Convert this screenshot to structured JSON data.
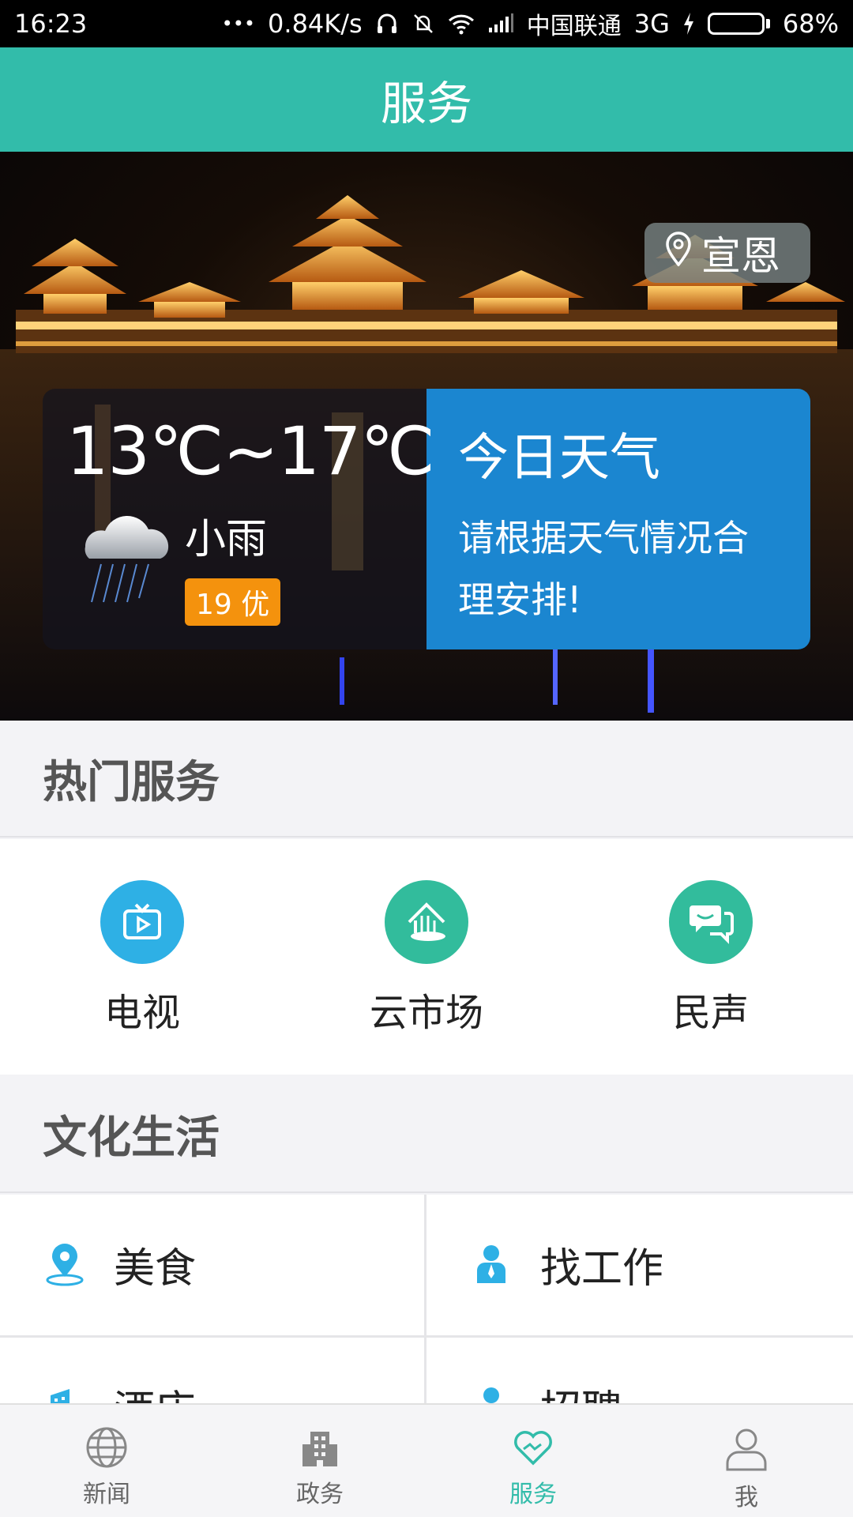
{
  "status_bar": {
    "time": "16:23",
    "dots": "•••",
    "speed": "0.84K/s",
    "carrier": "中国联通",
    "network": "3G",
    "battery": "68%",
    "battery_level": 0.68
  },
  "app_bar": {
    "title": "服务"
  },
  "hero": {
    "location": "宣恩",
    "weather": {
      "temp_range": "13℃~17℃",
      "condition": "小雨",
      "aqi": "19 优",
      "title": "今日天气",
      "desc_line1": "请根据天气情况合",
      "desc_line2": "理安排!"
    }
  },
  "hot_services": {
    "title": "热门服务",
    "items": [
      {
        "label": "电视",
        "icon": "tv-icon",
        "color": "#2eb0e5"
      },
      {
        "label": "云市场",
        "icon": "market-icon",
        "color": "#32bc9c"
      },
      {
        "label": "民声",
        "icon": "chat-icon",
        "color": "#32bc9c"
      }
    ]
  },
  "culture": {
    "title": "文化生活",
    "items": [
      {
        "label": "美食",
        "icon": "location-pin-icon"
      },
      {
        "label": "找工作",
        "icon": "person-icon"
      },
      {
        "label": "酒店",
        "icon": "building-icon"
      },
      {
        "label": "招聘",
        "icon": "person-icon"
      }
    ]
  },
  "bottom_nav": {
    "items": [
      {
        "label": "新闻",
        "icon": "globe-icon"
      },
      {
        "label": "政务",
        "icon": "government-building-icon"
      },
      {
        "label": "服务",
        "icon": "heart-icon",
        "active": true
      },
      {
        "label": "我",
        "icon": "user-icon"
      }
    ]
  },
  "colors": {
    "primary": "#32bcaa",
    "weather_panel": "#1b86d0",
    "aqi_badge": "#f4920d",
    "accent_blue": "#2eb0e5"
  }
}
